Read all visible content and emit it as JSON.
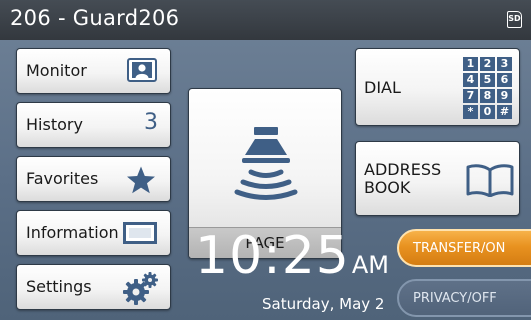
{
  "header": {
    "title": "206 - Guard206",
    "sd_label": "SD"
  },
  "menu": [
    {
      "label": "Monitor"
    },
    {
      "label": "History",
      "count": "3"
    },
    {
      "label": "Favorites"
    },
    {
      "label": "Information"
    },
    {
      "label": "Settings"
    }
  ],
  "page_button": {
    "label": "PAGE"
  },
  "dial_button": {
    "label": "DIAL",
    "keys": [
      "1",
      "2",
      "3",
      "4",
      "5",
      "6",
      "7",
      "8",
      "9",
      "*",
      "0",
      "#"
    ]
  },
  "address_book_button": {
    "line1": "ADDRESS",
    "line2": "BOOK"
  },
  "clock": {
    "time": "10:25",
    "ampm": "AM",
    "date": "Saturday, May 2"
  },
  "transfer": {
    "label": "TRANSFER/ON",
    "state": "on"
  },
  "privacy": {
    "label": "PRIVACY/OFF",
    "state": "off"
  },
  "colors": {
    "accent": "#e89220",
    "background": "#5a6f86",
    "titlebar": "#3a3f45"
  }
}
